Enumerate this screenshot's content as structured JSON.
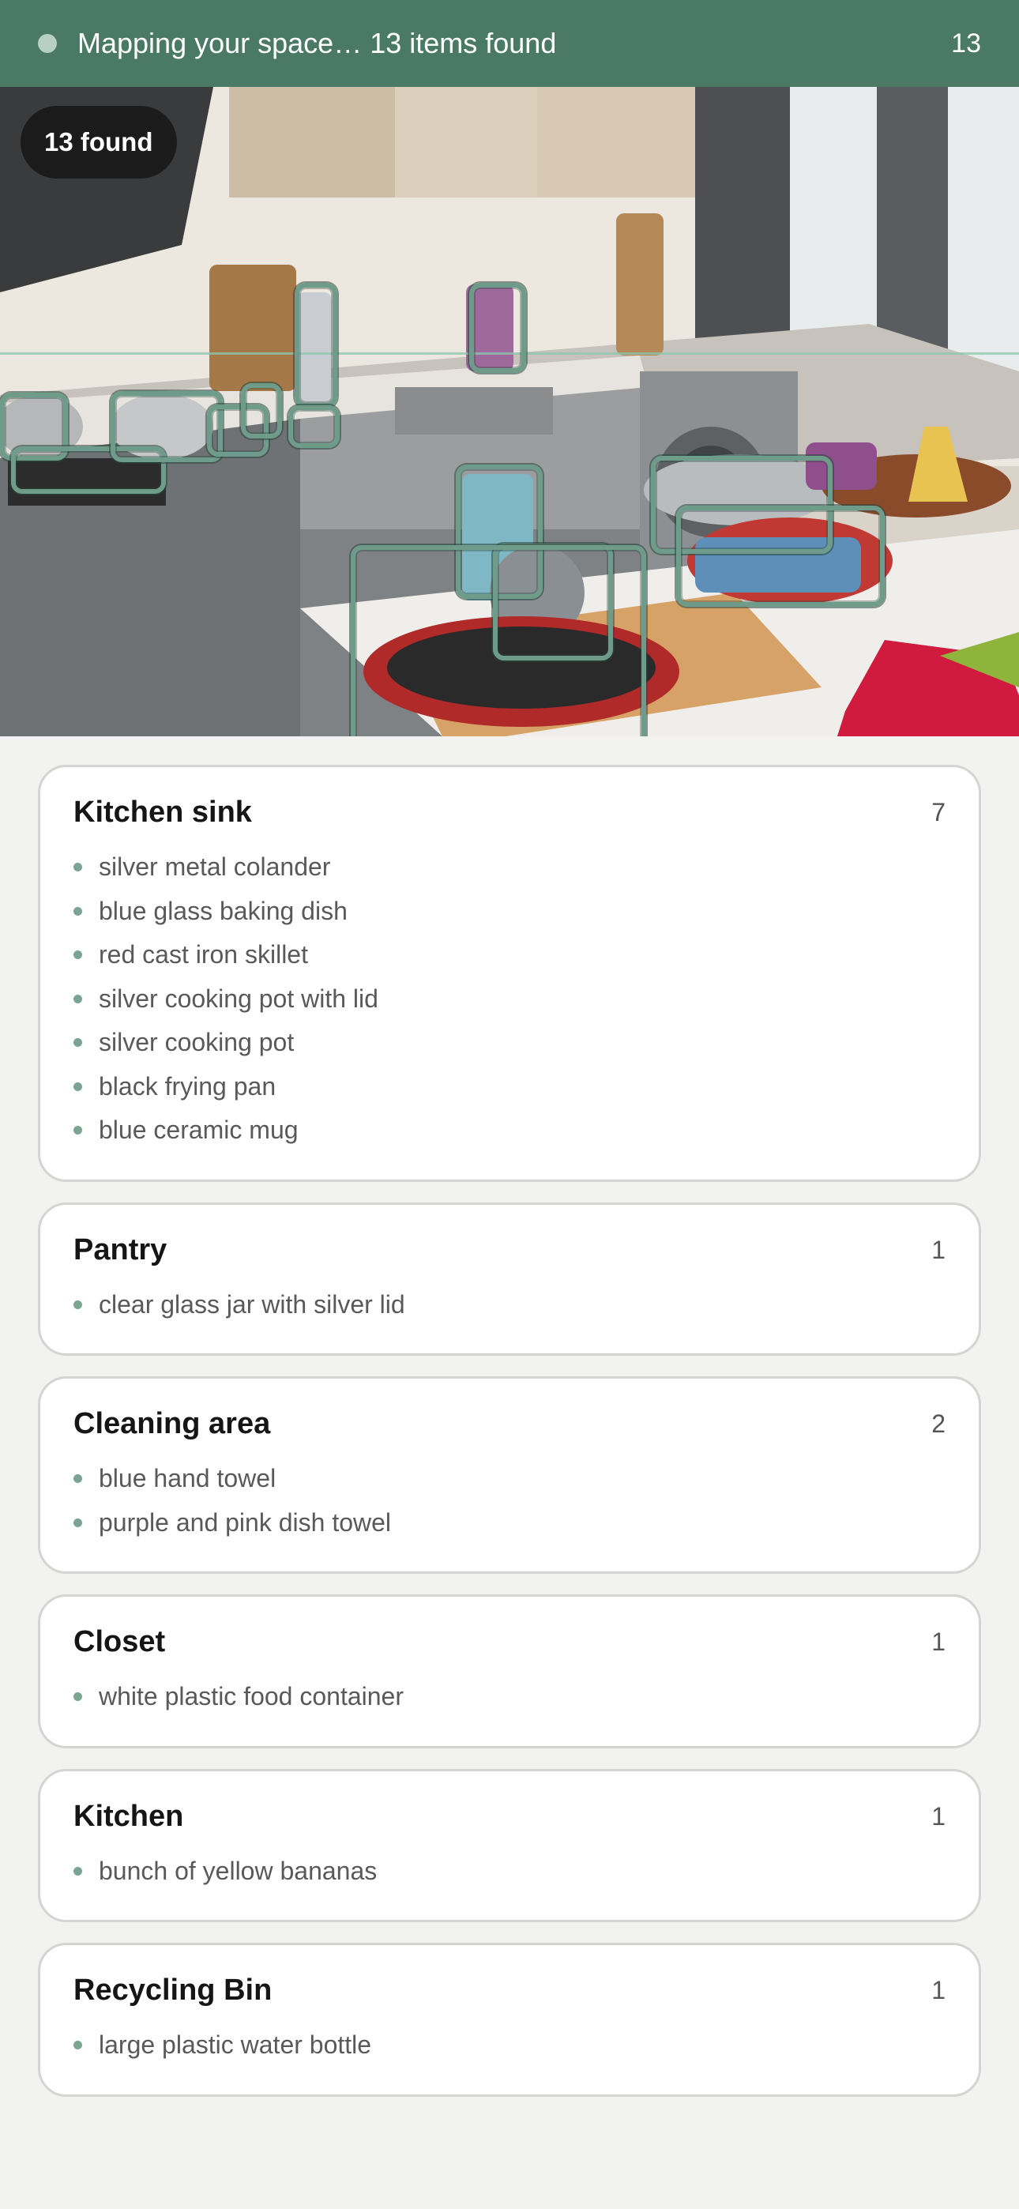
{
  "status": {
    "text": "Mapping your space… 13 items found",
    "count": "13"
  },
  "photo": {
    "found_label": "13 found",
    "accent_color": "#6f9c8a"
  },
  "groups": [
    {
      "title": "Kitchen sink",
      "count": "7",
      "items": [
        "silver metal colander",
        "blue glass baking dish",
        "red cast iron skillet",
        "silver cooking pot with lid",
        "silver cooking pot",
        "black frying pan",
        "blue ceramic mug"
      ]
    },
    {
      "title": "Pantry",
      "count": "1",
      "items": [
        "clear glass jar with silver lid"
      ]
    },
    {
      "title": "Cleaning area",
      "count": "2",
      "items": [
        "blue hand towel",
        "purple and pink dish towel"
      ]
    },
    {
      "title": "Closet",
      "count": "1",
      "items": [
        "white plastic food container"
      ]
    },
    {
      "title": "Kitchen",
      "count": "1",
      "items": [
        "bunch of yellow bananas"
      ]
    },
    {
      "title": "Recycling Bin",
      "count": "1",
      "items": [
        "large plastic water bottle"
      ]
    }
  ]
}
